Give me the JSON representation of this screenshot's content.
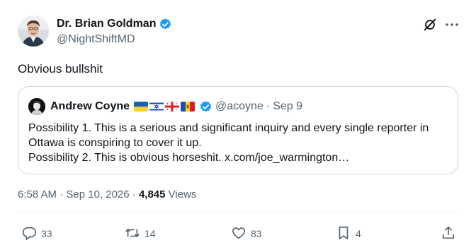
{
  "author": {
    "name": "Dr. Brian Goldman",
    "handle": "@NightShiftMD"
  },
  "tweet": {
    "text": "Obvious bullshit"
  },
  "quote": {
    "name": "Andrew Coyne",
    "flags": [
      "ukraine-flag",
      "israel-flag",
      "georgia-flag",
      "moldova-flag"
    ],
    "handle": "@acoyne",
    "separator": "·",
    "date": "Sep 9",
    "lines": [
      "Possibility 1. This is a serious and significant inquiry and every single reporter in Ottawa is conspiring to cover it up.",
      "Possibility 2. This is obvious horseshit. x.com/joe_warmington…"
    ]
  },
  "meta": {
    "time": "6:58 AM · Sep 10, 2026 · ",
    "views_count": "4,845",
    "views_label": " Views"
  },
  "actions": {
    "replies": "33",
    "reposts": "14",
    "likes": "83",
    "bookmarks": "4"
  },
  "colors": {
    "accent": "#1d9bf0",
    "text": "#0f1419",
    "secondary": "#536471",
    "border": "#cfd9de"
  }
}
